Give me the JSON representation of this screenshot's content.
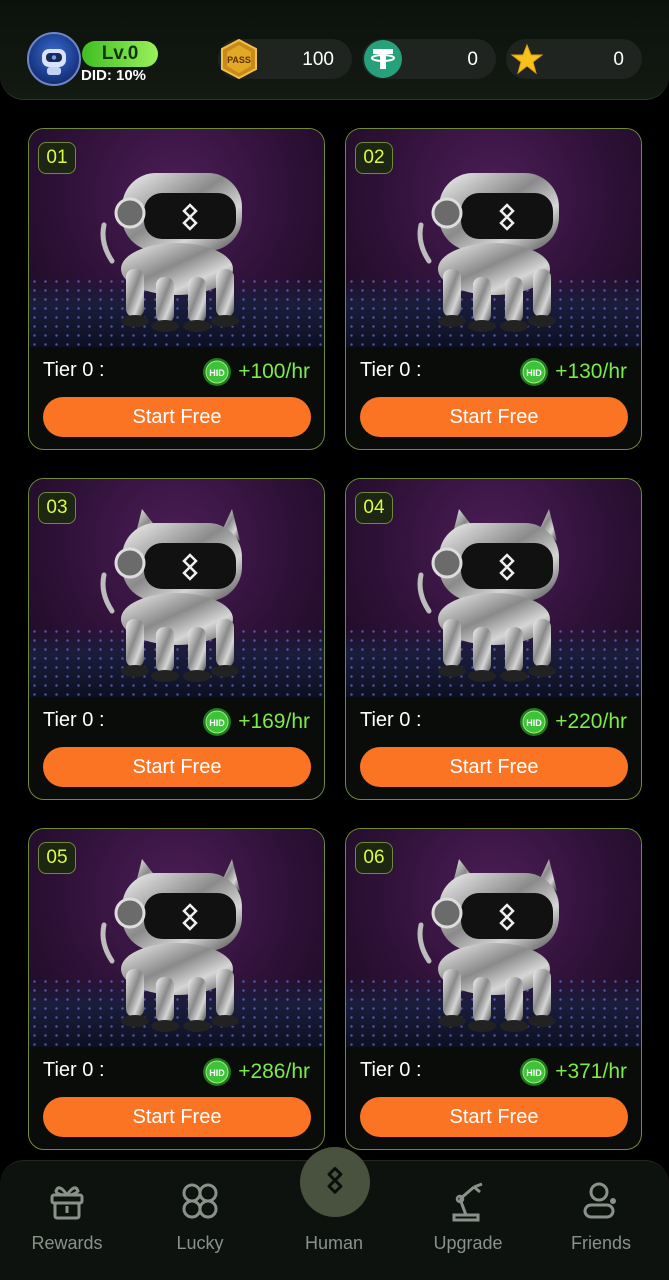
{
  "header": {
    "level": "Lv.0",
    "did": "DID: 10%",
    "avatar_icon": "robot-avatar-icon",
    "stats": [
      {
        "icon": "pass-icon",
        "label": "PASS",
        "value": "100"
      },
      {
        "icon": "tether-icon",
        "label": "",
        "value": "0"
      },
      {
        "icon": "star-icon",
        "label": "",
        "value": "0"
      }
    ]
  },
  "cards": [
    {
      "number": "01",
      "tier": "Tier 0 :",
      "rate": "+100/hr",
      "button": "Start Free"
    },
    {
      "number": "02",
      "tier": "Tier 0 :",
      "rate": "+130/hr",
      "button": "Start Free"
    },
    {
      "number": "03",
      "tier": "Tier 0 :",
      "rate": "+169/hr",
      "button": "Start Free"
    },
    {
      "number": "04",
      "tier": "Tier 0 :",
      "rate": "+220/hr",
      "button": "Start Free"
    },
    {
      "number": "05",
      "tier": "Tier 0 :",
      "rate": "+286/hr",
      "button": "Start Free"
    },
    {
      "number": "06",
      "tier": "Tier 0 :",
      "rate": "+371/hr",
      "button": "Start Free"
    }
  ],
  "coin_label": "HID",
  "nav": {
    "items": [
      {
        "label": "Rewards",
        "icon": "gift-icon"
      },
      {
        "label": "Lucky",
        "icon": "clover-icon"
      },
      {
        "label": "Human",
        "icon": "human-logo-icon"
      },
      {
        "label": "Upgrade",
        "icon": "robot-arm-icon"
      },
      {
        "label": "Friends",
        "icon": "friends-icon"
      }
    ]
  },
  "colors": {
    "accent": "#fb7424",
    "rate_green": "#7dea4c",
    "number_yellow": "#d8ff3a",
    "card_border": "#6f8a38",
    "level_green": "#3fbf22"
  }
}
